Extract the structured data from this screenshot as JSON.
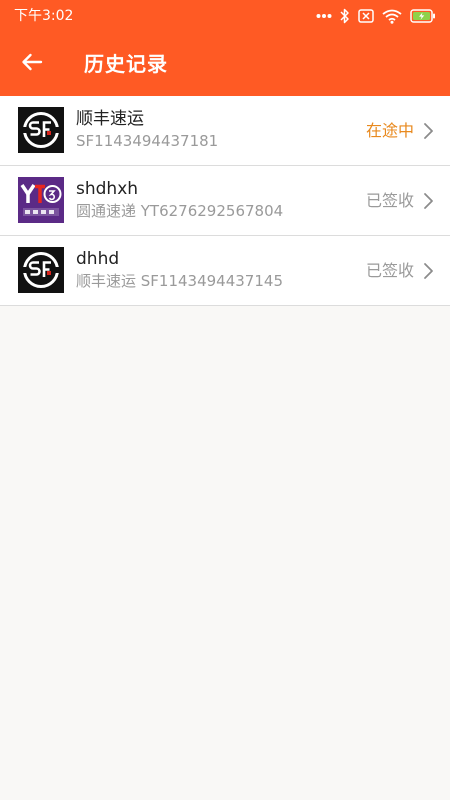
{
  "status_bar": {
    "time": "下午3:02",
    "icons": [
      "more-dots-icon",
      "bluetooth-icon",
      "no-sim-icon",
      "wifi-icon",
      "battery-charging-icon"
    ]
  },
  "header": {
    "title": "历史记录",
    "back_icon": "arrow-left-icon"
  },
  "colors": {
    "header": "#ff5a24",
    "status_active": "#e8891e",
    "status_done": "#9a9a9a",
    "yto_purple": "#5b2a86"
  },
  "records": [
    {
      "logo": "sf-express-logo",
      "title": "顺丰速运",
      "subtitle": "SF1143494437181",
      "status": "在途中"
    },
    {
      "logo": "yto-express-logo",
      "title": "shdhxh",
      "subtitle": "圆通速递 YT6276292567804",
      "status": "已签收"
    },
    {
      "logo": "sf-express-logo",
      "title": "dhhd",
      "subtitle": "顺丰速运 SF1143494437145",
      "status": "已签收"
    }
  ]
}
